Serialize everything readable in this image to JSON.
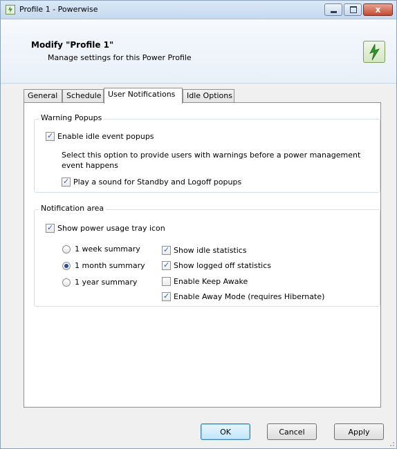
{
  "window": {
    "title": "Profile 1 - Powerwise",
    "controls": {
      "close": "x"
    }
  },
  "header": {
    "title": "Modify \"Profile 1\"",
    "subtitle": "Manage settings for this Power Profile"
  },
  "tabs": [
    {
      "label": "General"
    },
    {
      "label": "Schedule"
    },
    {
      "label": "User Notifications",
      "active": true
    },
    {
      "label": "Idle Options"
    }
  ],
  "warning_popups": {
    "title": "Warning Popups",
    "enable_idle_popups": {
      "label": "Enable idle event popups",
      "checked": true
    },
    "description": "Select this option to provide users with warnings before a power management event happens",
    "play_sound": {
      "label": "Play a sound for Standby and Logoff popups",
      "checked": true
    }
  },
  "notification_area": {
    "title": "Notification area",
    "show_tray_icon": {
      "label": "Show power usage tray icon",
      "checked": true
    },
    "summary_options": [
      {
        "label": "1 week summary",
        "selected": false
      },
      {
        "label": "1 month summary",
        "selected": true
      },
      {
        "label": "1 year summary",
        "selected": false
      }
    ],
    "options": [
      {
        "label": "Show idle statistics",
        "checked": true
      },
      {
        "label": "Show logged off statistics",
        "checked": true
      },
      {
        "label": "Enable Keep Awake",
        "checked": false
      },
      {
        "label": "Enable Away Mode (requires Hibernate)",
        "checked": true
      }
    ]
  },
  "buttons": {
    "ok": "OK",
    "cancel": "Cancel",
    "apply": "Apply"
  }
}
